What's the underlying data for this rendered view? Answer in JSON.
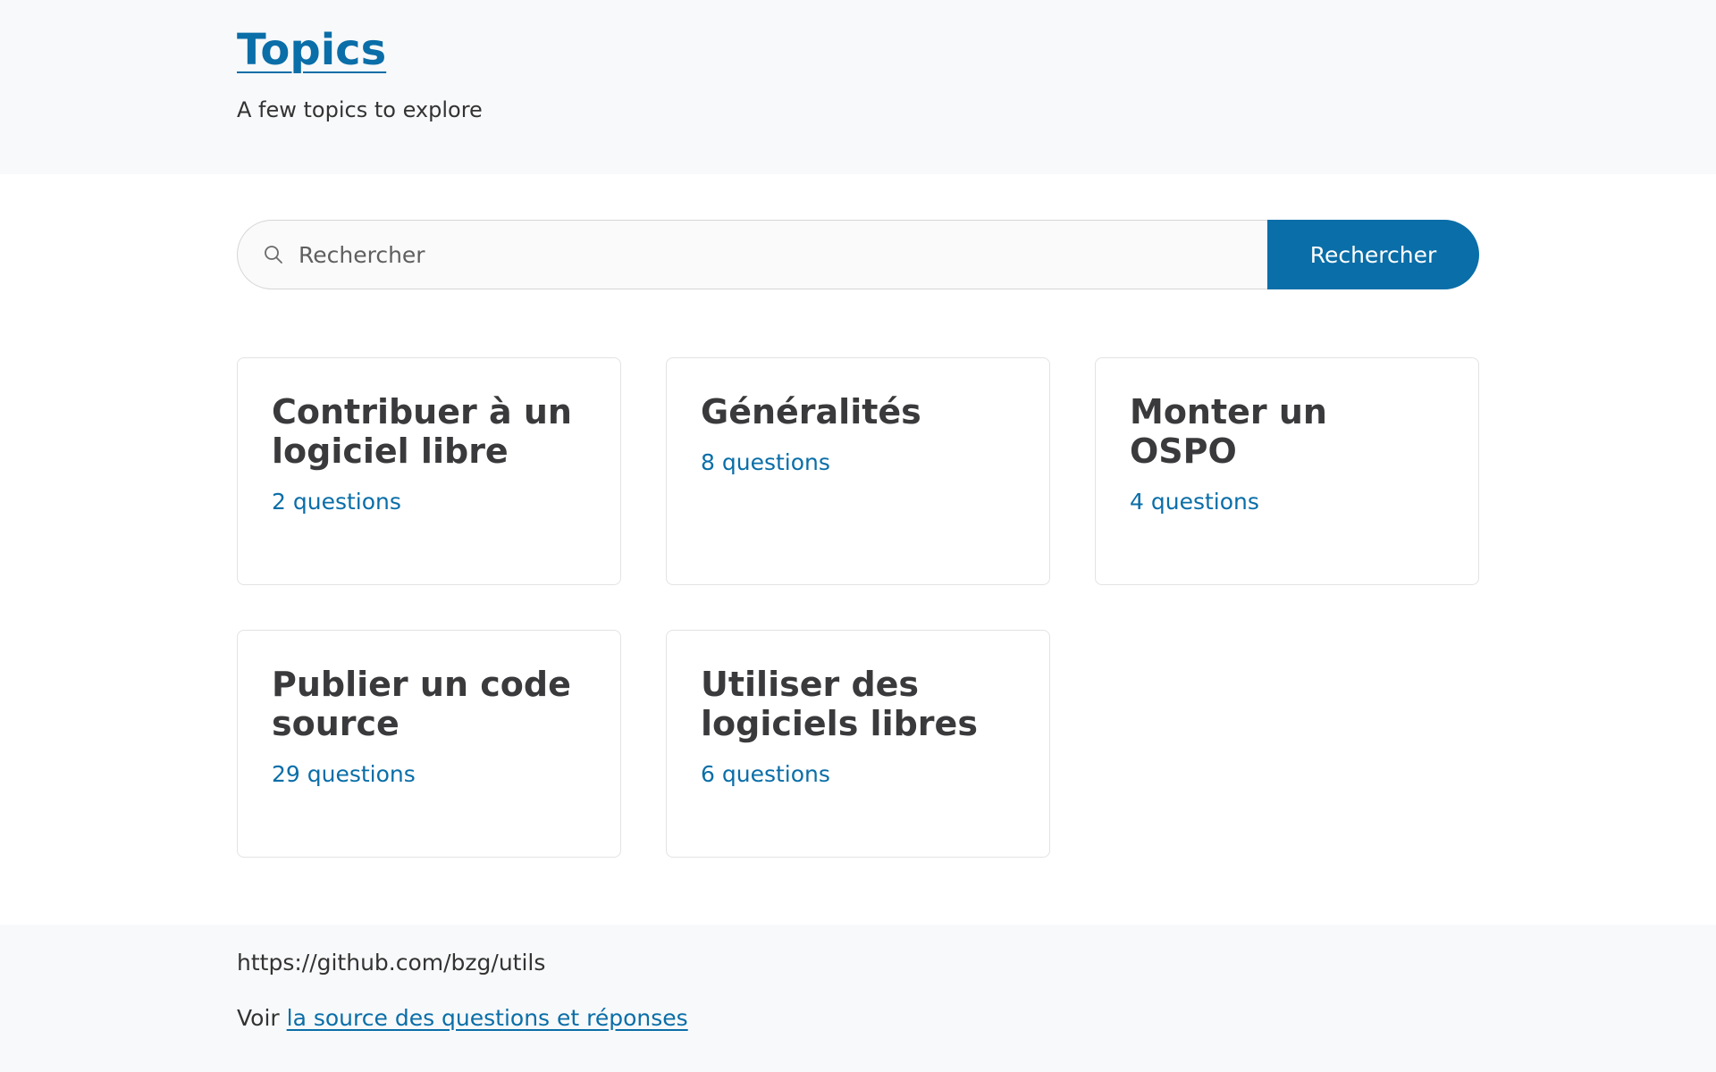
{
  "header": {
    "title": "Topics",
    "subtitle": "A few topics to explore"
  },
  "search": {
    "placeholder": "Rechercher",
    "value": "",
    "button_label": "Rechercher",
    "icon": "search-icon"
  },
  "topics": [
    {
      "title": "Contribuer à un logiciel libre",
      "count": "2 questions"
    },
    {
      "title": "Généralités",
      "count": "8 questions"
    },
    {
      "title": "Monter un OSPO",
      "count": "4 questions"
    },
    {
      "title": "Publier un code source",
      "count": "29 questions"
    },
    {
      "title": "Utiliser des logiciels libres",
      "count": "6 questions"
    }
  ],
  "footer": {
    "url": "https://github.com/bzg/utils",
    "source_prefix": "Voir",
    "source_link": "la source des questions et réponses"
  },
  "colors": {
    "accent": "#0a6ea8",
    "header_bg": "#f8f9fa",
    "card_border": "#e3e3e3",
    "title_text": "#3a3a3c"
  }
}
